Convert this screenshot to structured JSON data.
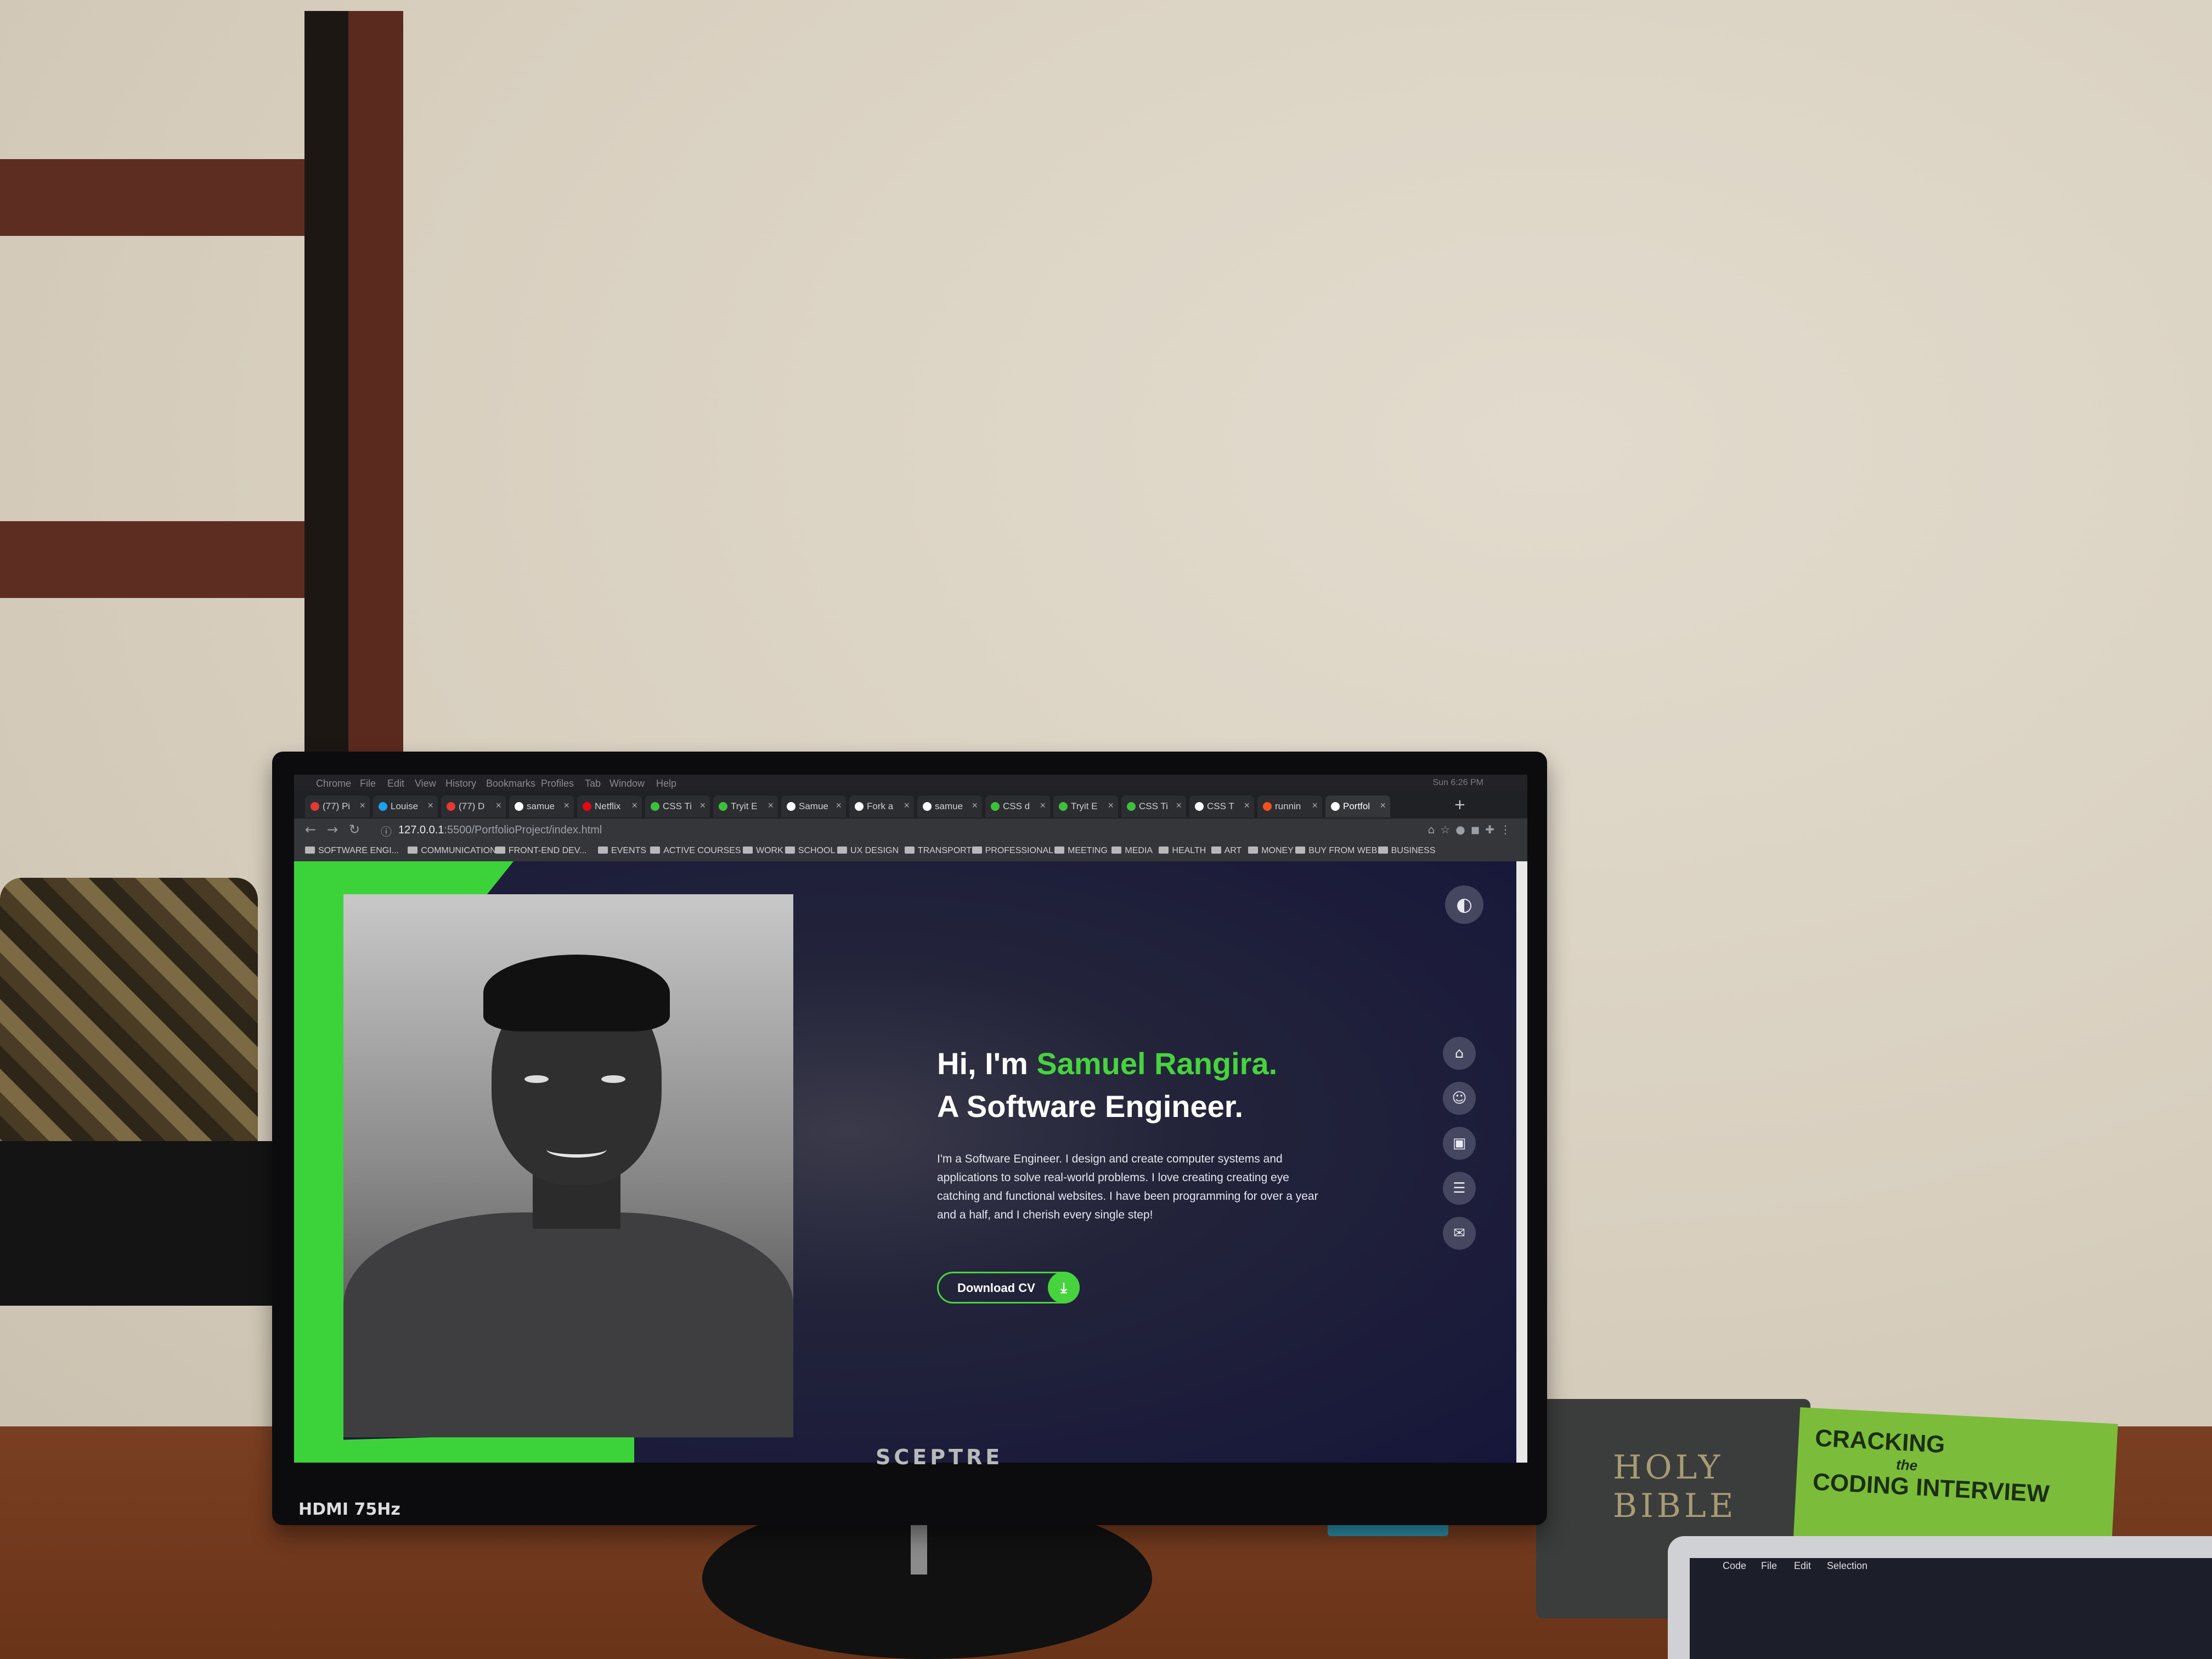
{
  "browser": {
    "menu": [
      "Chrome",
      "File",
      "Edit",
      "View",
      "History",
      "Bookmarks",
      "Profiles",
      "Tab",
      "Window",
      "Help"
    ],
    "status_right": "Sun 6:26 PM",
    "tabs": [
      {
        "label": "(77) Pi",
        "color": "#e53935"
      },
      {
        "label": "Louise",
        "color": "#1da1f2"
      },
      {
        "label": "(77) D",
        "color": "#e53935"
      },
      {
        "label": "samue",
        "color": "#ffffff"
      },
      {
        "label": "Netflix",
        "color": "#e50914"
      },
      {
        "label": "CSS Ti",
        "color": "#3cc13c"
      },
      {
        "label": "Tryit E",
        "color": "#3cc13c"
      },
      {
        "label": "Samue",
        "color": "#ffffff"
      },
      {
        "label": "Fork a",
        "color": "#ffffff"
      },
      {
        "label": "samue",
        "color": "#ffffff"
      },
      {
        "label": "CSS d",
        "color": "#3cc13c"
      },
      {
        "label": "Tryit E",
        "color": "#3cc13c"
      },
      {
        "label": "CSS Ti",
        "color": "#3cc13c"
      },
      {
        "label": "CSS T",
        "color": "#ffffff"
      },
      {
        "label": "runnin",
        "color": "#f4511e"
      },
      {
        "label": "Portfol",
        "color": "#ffffff"
      }
    ],
    "url_host": "127.0.0.1",
    "url_path": ":5500/PortfolioProject/index.html",
    "bookmarks": [
      "SOFTWARE ENGI...",
      "COMMUNICATION",
      "FRONT-END DEV...",
      "EVENTS",
      "ACTIVE COURSES",
      "WORK",
      "SCHOOL",
      "UX DESIGN",
      "TRANSPORT",
      "PROFESSIONAL",
      "MEETING",
      "MEDIA",
      "HEALTH",
      "ART",
      "MONEY",
      "BUY FROM WEB",
      "BUSINESS"
    ]
  },
  "hero": {
    "greeting": "Hi, I'm ",
    "name": "Samuel Rangira.",
    "role": "A Software Engineer.",
    "bio": "I'm a Software Engineer. I design and create computer systems and applications to solve real-world problems. I love creating creating eye catching and functional websites. I have been programming for over a year and a half, and I cherish every single step!",
    "cta_label": "Download CV",
    "accent_color": "#47d33e"
  },
  "icons": {
    "theme_toggle": "contrast-icon",
    "nav": [
      "home-icon",
      "user-icon",
      "briefcase-icon",
      "newspaper-icon",
      "envelope-icon"
    ],
    "download": "download-icon"
  },
  "monitor": {
    "brand": "SCEPTRE",
    "hdmi": "HDMI 75Hz"
  },
  "scene": {
    "book1": "HOLY BIBLE",
    "book2_line1": "CRACKING",
    "book2_line2": "the",
    "book2_line3": "CODING INTERVIEW",
    "laptop_menu": [
      "Code",
      "File",
      "Edit",
      "Selection"
    ]
  }
}
